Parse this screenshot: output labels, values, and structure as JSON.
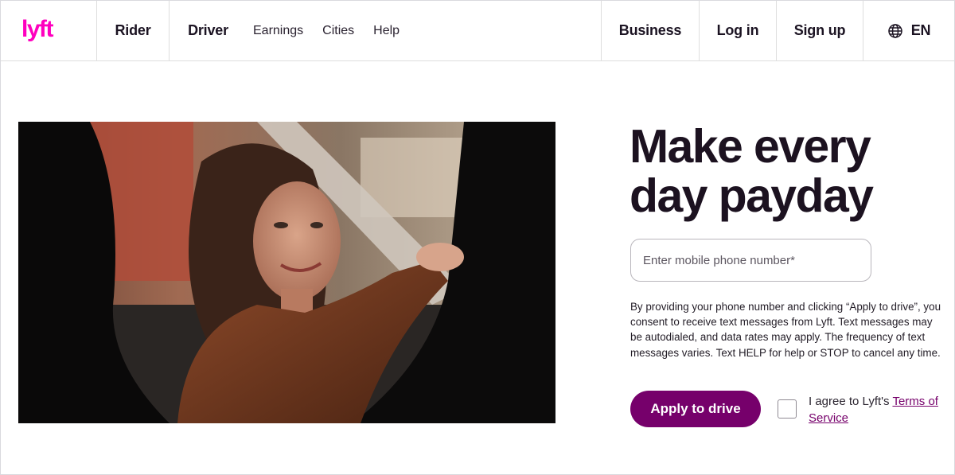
{
  "brand": {
    "logo_text": "lyft",
    "color": "#ff00bf",
    "accent": "#76006b"
  },
  "nav": {
    "rider": "Rider",
    "driver": "Driver",
    "links": [
      "Earnings",
      "Cities",
      "Help"
    ],
    "business": "Business",
    "login": "Log in",
    "signup": "Sign up",
    "language": "EN",
    "language_icon": "globe-icon"
  },
  "hero": {
    "image_alt": "Woman smiling from driver's seat of a car",
    "headline_line1": "Make every",
    "headline_line2": "day payday"
  },
  "form": {
    "phone_placeholder": "Enter mobile phone number*",
    "phone_value": "",
    "consent_text": "By providing your phone number and clicking “Apply to drive”, you consent to receive text messages from Lyft. Text messages may be autodialed, and data rates may apply. The frequency of text messages varies. Text HELP for help or STOP to cancel any time.",
    "apply_label": "Apply to drive",
    "agree_prefix": "I agree to Lyft's ",
    "tos_link": "Terms of Service",
    "agree_checked": false
  }
}
